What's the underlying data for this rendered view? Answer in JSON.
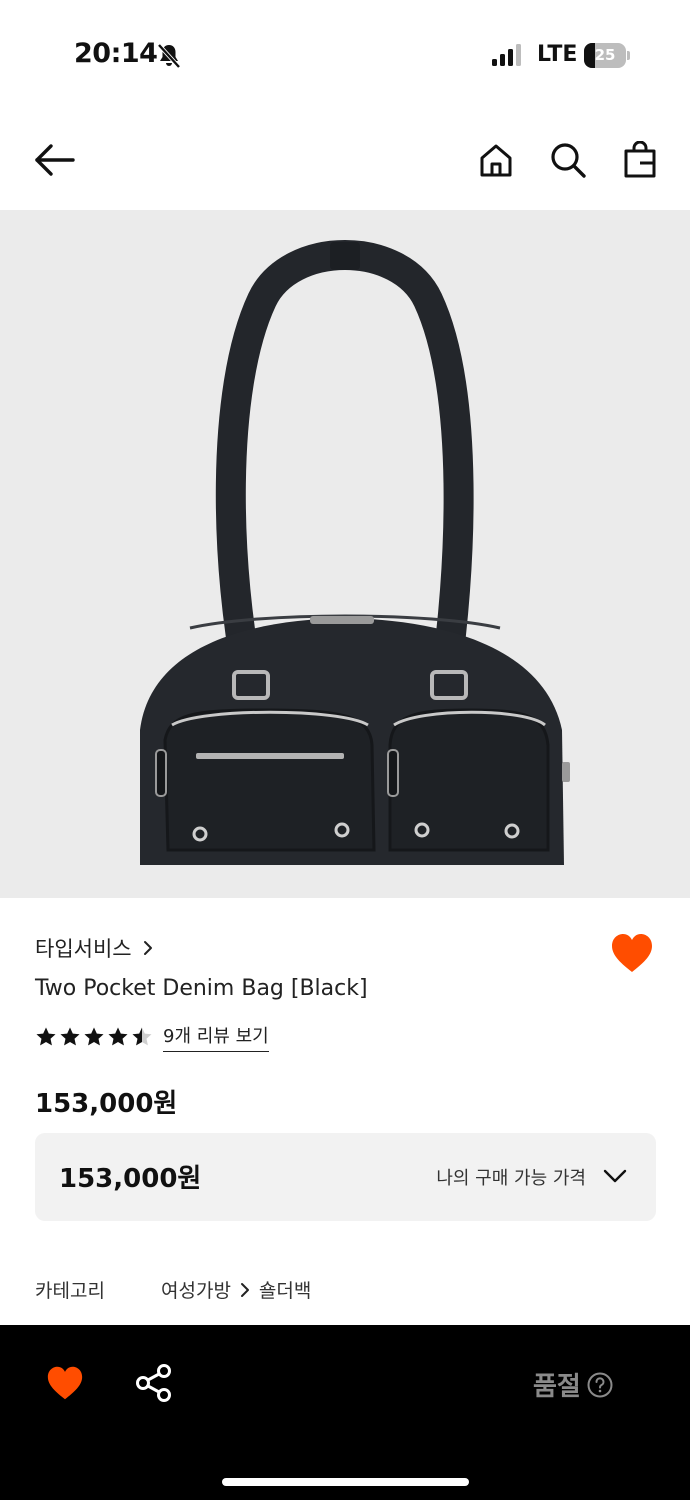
{
  "status_bar": {
    "time": "20:14",
    "network": "LTE",
    "battery": "25",
    "battery_level": 0.25
  },
  "nav": {
    "back_icon": "arrow-left-icon",
    "home_icon": "home-icon",
    "search_icon": "search-icon",
    "cart_icon": "shopping-bag-icon"
  },
  "product": {
    "image_alt_icon": "product-photo",
    "brand": "타입서비스",
    "name": "Two Pocket Denim Bag [Black]",
    "rating": 4.5,
    "rating_max": 5,
    "review_link": "9개 리뷰 보기",
    "price": "153,000원",
    "wish_color": "#ff4d00"
  },
  "price_box": {
    "value": "153,000원",
    "label": "나의 구매 가능 가격"
  },
  "category": {
    "label": "카테고리",
    "path": [
      "여성가방",
      "숄더백"
    ]
  },
  "bottom_bar": {
    "soldout_label": "품절",
    "heart_color": "#ff4d00"
  }
}
